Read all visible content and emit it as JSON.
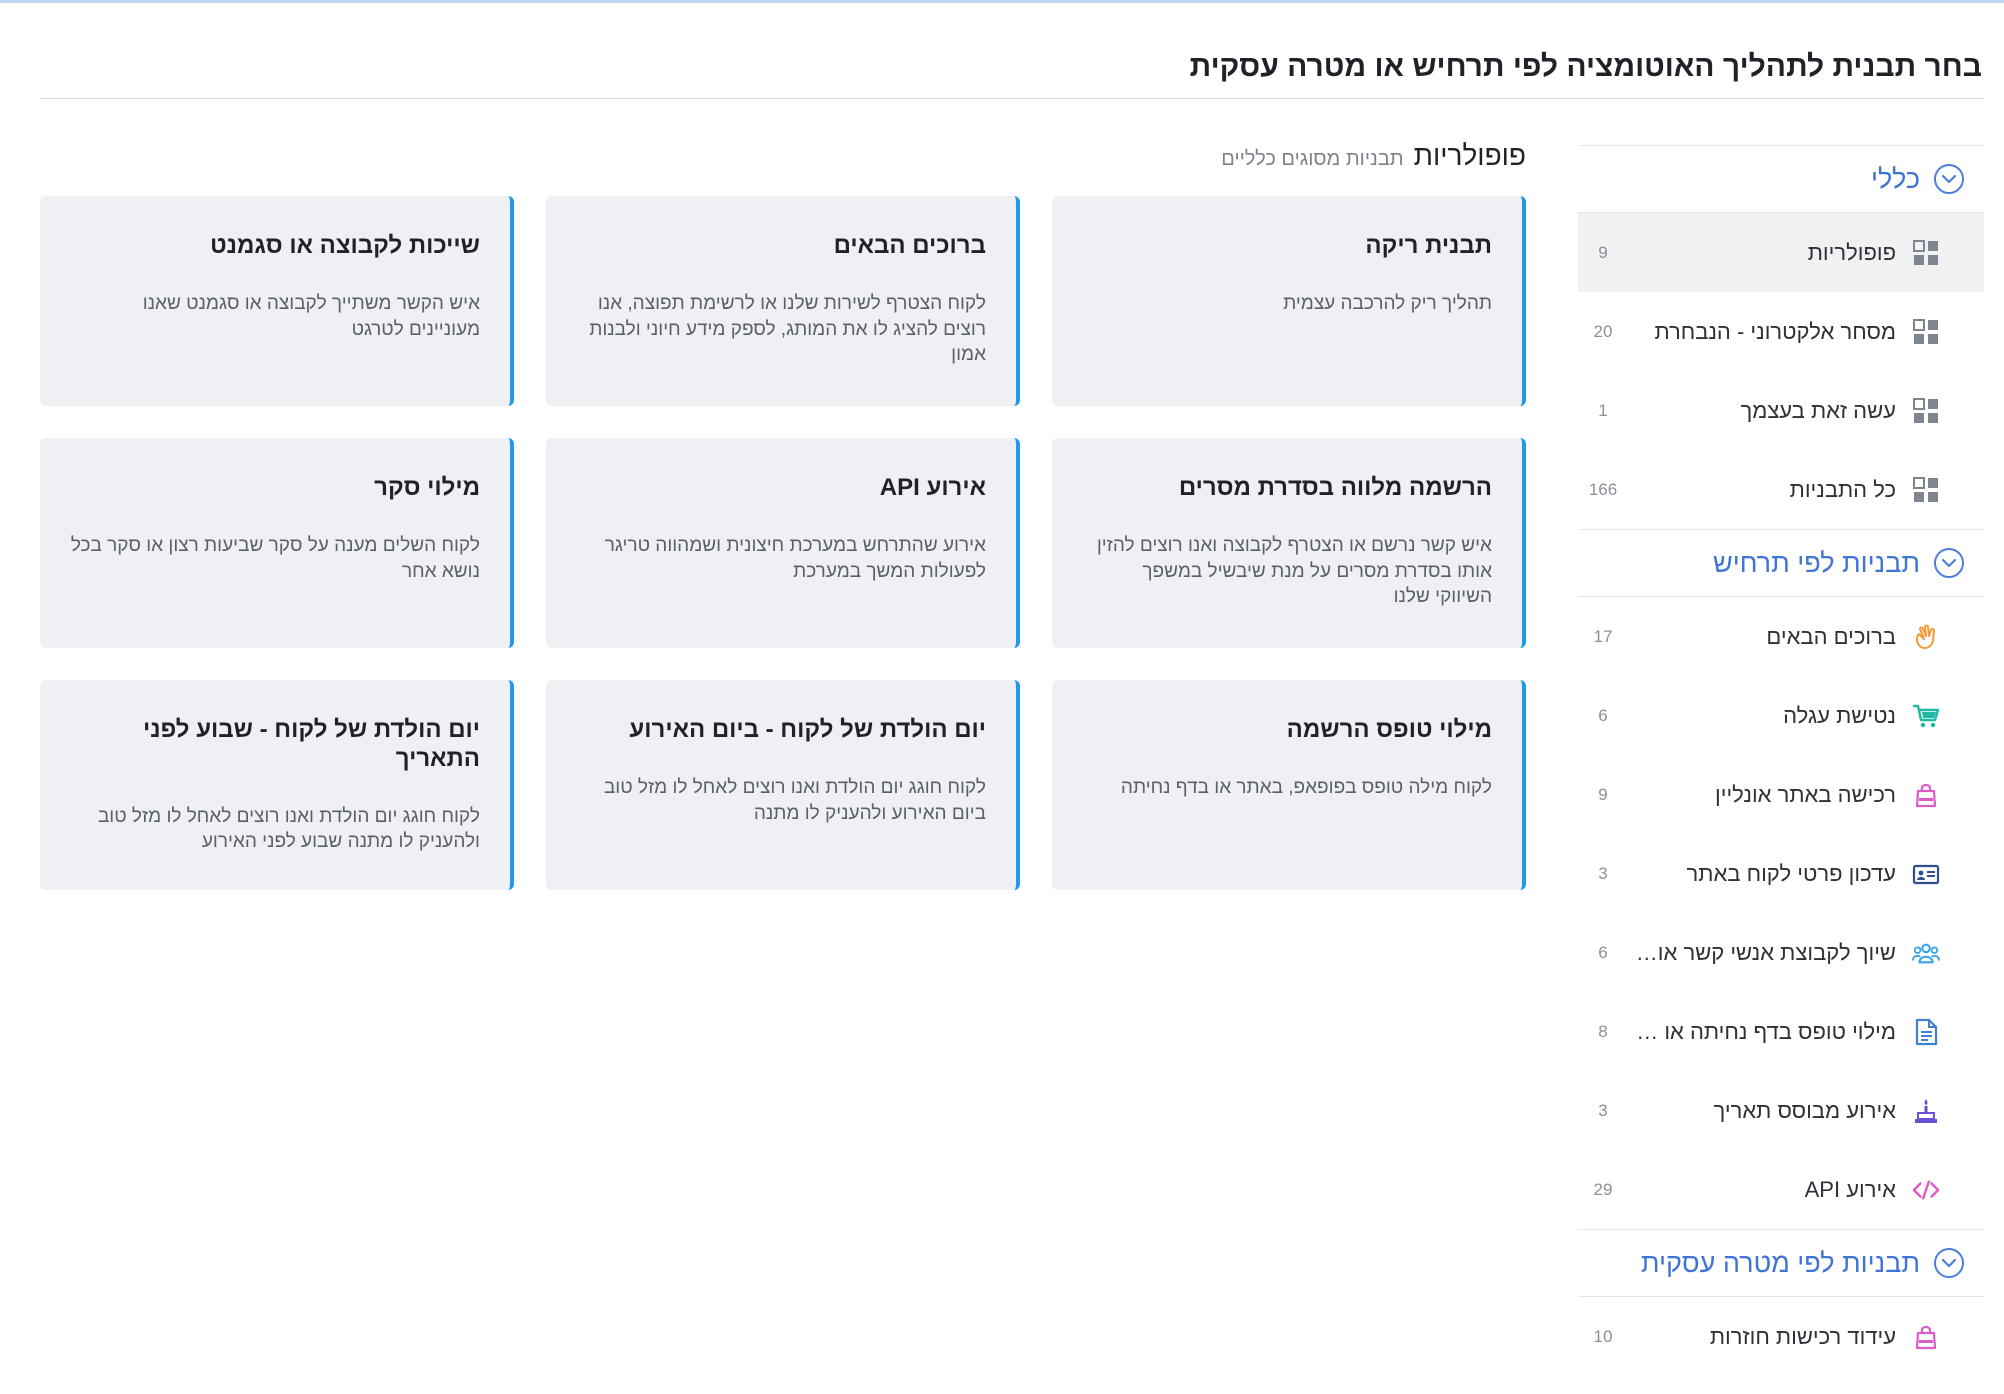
{
  "page": {
    "title": "בחר תבנית לתהליך האוטומציה לפי תרחיש או מטרה עסקית"
  },
  "sidebar": {
    "general": {
      "title": "כללי",
      "items": [
        {
          "label": "פופולריות",
          "count": "9",
          "icon": "grid-icon"
        },
        {
          "label": "מסחר אלקטרוני - הנבחרת",
          "count": "20",
          "icon": "grid-icon"
        },
        {
          "label": "עשה זאת בעצמך",
          "count": "1",
          "icon": "grid-icon"
        },
        {
          "label": "כל התבניות",
          "count": "166",
          "icon": "grid-icon"
        }
      ]
    },
    "scenarios": {
      "title": "תבניות לפי תרחיש",
      "items": [
        {
          "label": "ברוכים הבאים",
          "count": "17",
          "icon": "waving-hand-icon",
          "color": "#f39a3a"
        },
        {
          "label": "נטישת עגלה",
          "count": "6",
          "icon": "shopping-cart-icon",
          "color": "#1fb8a5"
        },
        {
          "label": "רכישה באתר אונליין",
          "count": "9",
          "icon": "shopping-bag-icon",
          "color": "#d95cc7"
        },
        {
          "label": "עדכון פרטי לקוח באתר",
          "count": "3",
          "icon": "id-card-icon",
          "color": "#2f4f8f"
        },
        {
          "label": "שיוך לקבוצת אנשי קשר או סגמנט",
          "count": "6",
          "icon": "users-group-icon",
          "color": "#3aa3e6"
        },
        {
          "label": "מילוי טופס בדף נחיתה או סקר",
          "count": "8",
          "icon": "document-icon",
          "color": "#3f7fd6"
        },
        {
          "label": "אירוע מבוסס תאריך",
          "count": "3",
          "icon": "cake-icon",
          "color": "#6b4fd6"
        },
        {
          "label": "אירוע API",
          "count": "29",
          "icon": "code-icon",
          "color": "#e05ac4"
        }
      ]
    },
    "goals": {
      "title": "תבניות לפי מטרה עסקית",
      "items": [
        {
          "label": "עידוד רכישות חוזרות",
          "count": "10",
          "icon": "shopping-bag-icon",
          "color": "#d95cc7"
        }
      ]
    }
  },
  "main": {
    "title": "פופולריות",
    "subtitle": "תבניות מסוגים כלליים",
    "cards": [
      {
        "title": "תבנית ריקה",
        "desc": "תהליך ריק להרכבה עצמית"
      },
      {
        "title": "ברוכים הבאים",
        "desc": "לקוח הצטרף לשירות שלנו או לרשימת תפוצה, אנו רוצים להציג לו את המותג, לספק מידע חיוני ולבנות אמון"
      },
      {
        "title": "שייכות לקבוצה או סגמנט",
        "desc": "איש הקשר משתייך לקבוצה או סגמנט שאנו מעוניינים לטרגט"
      },
      {
        "title": "הרשמה מלווה בסדרת מסרים",
        "desc": "איש קשר נרשם או הצטרף לקבוצה ואנו רוצים להזין אותו בסדרת מסרים על מנת שיבשיל במשפך השיווקי שלנו"
      },
      {
        "title": "אירוע API",
        "desc": "אירוע שהתרחש במערכת חיצונית ושמהווה טריגר לפעולות המשך במערכת"
      },
      {
        "title": "מילוי סקר",
        "desc": "לקוח השלים מענה על סקר שביעות רצון או סקר בכל נושא אחר"
      },
      {
        "title": "מילוי טופס הרשמה",
        "desc": "לקוח מילה טופס בפופאפ, באתר או בדף נחיתה"
      },
      {
        "title": "יום הולדת של לקוח - ביום האירוע",
        "desc": "לקוח חוגג יום הולדת ואנו רוצים לאחל לו מזל טוב ביום האירוע ולהעניק לו מתנה"
      },
      {
        "title": "יום הולדת של לקוח - שבוע לפני התאריך",
        "desc": "לקוח חוגג יום הולדת ואנו רוצים לאחל לו מזל טוב ולהעניק לו מתנה שבוע לפני האירוע"
      }
    ]
  },
  "colors": {
    "accent": "#3f74d6",
    "card_border": "#1e9ae6",
    "card_bg": "#eef0f4"
  }
}
